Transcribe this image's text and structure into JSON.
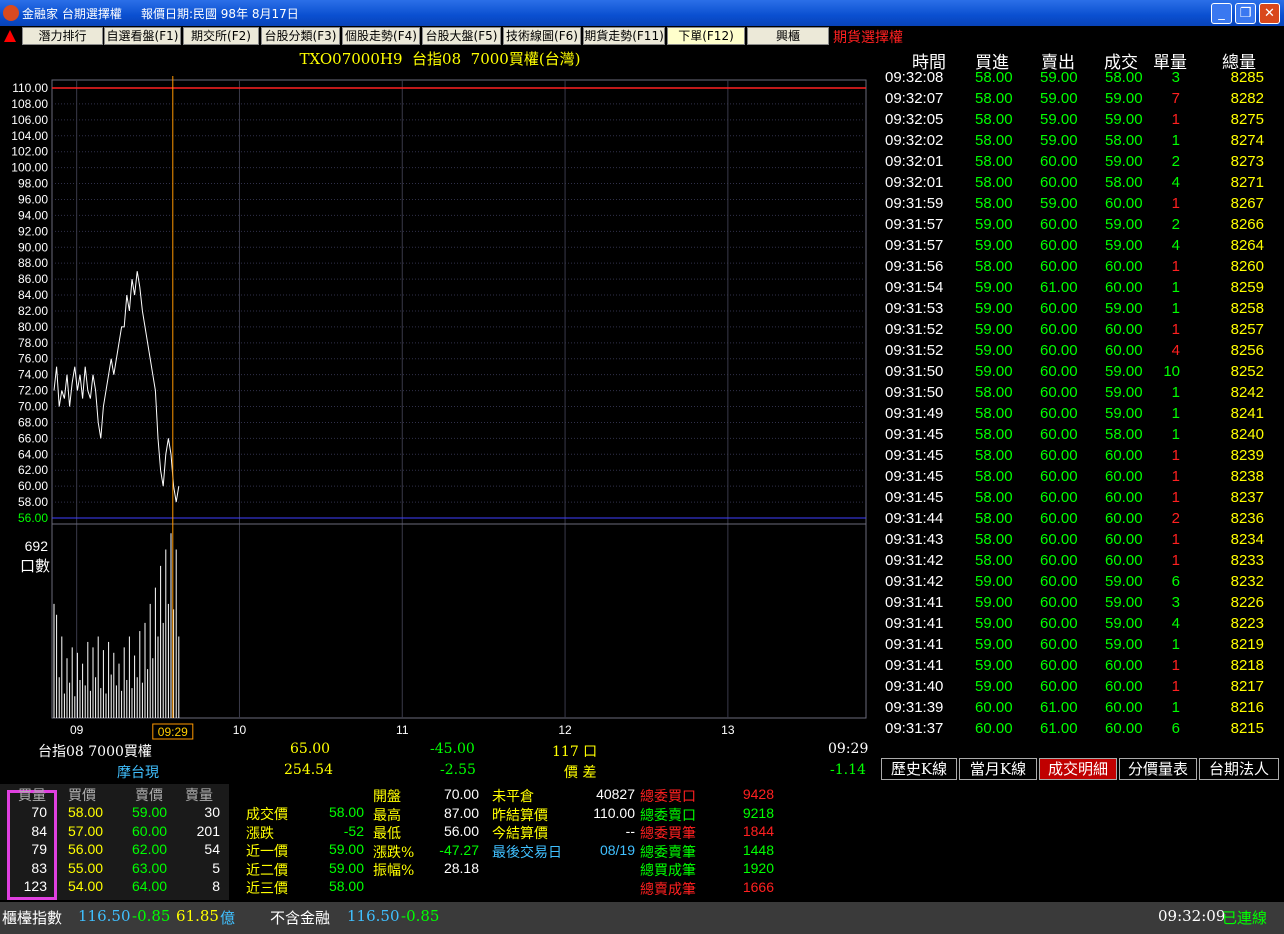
{
  "window": {
    "app_name": "金融家",
    "window_name": "台期選擇權",
    "quote_date": "報價日期:民國 98年 8月17日"
  },
  "tabs": [
    {
      "label": "潛力排行",
      "active": false
    },
    {
      "label": "自選看盤(F1)",
      "active": false
    },
    {
      "label": "期交所(F2)",
      "active": false
    },
    {
      "label": "台股分類(F3)",
      "active": false
    },
    {
      "label": "個股走勢(F4)",
      "active": false
    },
    {
      "label": "台股大盤(F5)",
      "active": false
    },
    {
      "label": "技術線圖(F6)",
      "active": false
    },
    {
      "label": "期貨走勢(F11)",
      "active": false
    },
    {
      "label": "下單(F12)",
      "active": true
    },
    {
      "label": "興櫃",
      "active": false
    }
  ],
  "futures_label": "期貨選擇權",
  "chart_title": "TXO07000H9  台指08  7000買權(台灣)",
  "chart_data": {
    "type": "line",
    "ylim": [
      56,
      110
    ],
    "y_ticks": [
      "110.00",
      "108.00",
      "106.00",
      "104.00",
      "102.00",
      "100.00",
      "98.00",
      "96.00",
      "94.00",
      "92.00",
      "90.00",
      "88.00",
      "86.00",
      "84.00",
      "82.00",
      "80.00",
      "78.00",
      "76.00",
      "74.00",
      "72.00",
      "70.00",
      "68.00",
      "66.00",
      "64.00",
      "62.00",
      "60.00",
      "58.00",
      "56.00"
    ],
    "ref_line": 110,
    "low_line": 56,
    "prices": [
      72,
      75,
      70,
      72,
      71,
      74,
      70,
      73,
      75,
      72,
      74,
      71,
      75,
      72,
      71,
      74,
      72,
      68,
      66,
      70,
      72,
      74,
      76,
      74,
      76,
      78,
      80,
      80,
      84,
      82,
      86,
      84,
      87,
      85,
      82,
      80,
      78,
      76,
      74,
      72,
      66,
      62,
      60,
      64,
      66,
      64,
      60,
      58,
      60
    ],
    "x_ticks": [
      {
        "label": "09",
        "slot": 5
      },
      {
        "label": "10",
        "slot": 38
      },
      {
        "label": "11",
        "slot": 71
      },
      {
        "label": "12",
        "slot": 104
      },
      {
        "label": "13",
        "slot": 137
      }
    ],
    "cursor_label": "09:29",
    "volume_max_label": "692",
    "volume_unit": "口數",
    "volume_max": 692,
    "volumes": [
      420,
      380,
      150,
      300,
      90,
      220,
      130,
      260,
      80,
      240,
      140,
      200,
      120,
      280,
      100,
      260,
      150,
      300,
      110,
      250,
      90,
      280,
      160,
      240,
      120,
      200,
      100,
      260,
      140,
      300,
      110,
      230,
      150,
      320,
      130,
      350,
      180,
      420,
      220,
      480,
      300,
      560,
      350,
      620,
      420,
      680,
      400,
      620,
      300
    ]
  },
  "info_row1": {
    "name": "台指08  7000買權",
    "price": "65.00",
    "change": "-45.00",
    "volume": "117 口",
    "time": "09:29"
  },
  "info_row2": {
    "name": "摩台現",
    "price": "254.54",
    "change": "-2.55",
    "label": "價 差",
    "spread": "-1.14"
  },
  "trades_header": [
    "時間",
    "買進",
    "賣出",
    "成交",
    "單量",
    "總量"
  ],
  "trades": [
    {
      "t": "09:32:08",
      "b": "58.00",
      "s": "59.00",
      "p": "58.00",
      "q": "3",
      "tot": "8285",
      "qc": "#00ff00"
    },
    {
      "t": "09:32:07",
      "b": "58.00",
      "s": "59.00",
      "p": "59.00",
      "q": "7",
      "tot": "8282",
      "qc": "#ff2020"
    },
    {
      "t": "09:32:05",
      "b": "58.00",
      "s": "59.00",
      "p": "59.00",
      "q": "1",
      "tot": "8275",
      "qc": "#ff2020"
    },
    {
      "t": "09:32:02",
      "b": "58.00",
      "s": "59.00",
      "p": "58.00",
      "q": "1",
      "tot": "8274",
      "qc": "#00ff00"
    },
    {
      "t": "09:32:01",
      "b": "58.00",
      "s": "60.00",
      "p": "59.00",
      "q": "2",
      "tot": "8273",
      "qc": "#00ff00"
    },
    {
      "t": "09:32:01",
      "b": "58.00",
      "s": "60.00",
      "p": "58.00",
      "q": "4",
      "tot": "8271",
      "qc": "#00ff00"
    },
    {
      "t": "09:31:59",
      "b": "58.00",
      "s": "59.00",
      "p": "60.00",
      "q": "1",
      "tot": "8267",
      "qc": "#ff2020"
    },
    {
      "t": "09:31:57",
      "b": "59.00",
      "s": "60.00",
      "p": "59.00",
      "q": "2",
      "tot": "8266",
      "qc": "#00ff00"
    },
    {
      "t": "09:31:57",
      "b": "59.00",
      "s": "60.00",
      "p": "59.00",
      "q": "4",
      "tot": "8264",
      "qc": "#00ff00"
    },
    {
      "t": "09:31:56",
      "b": "58.00",
      "s": "60.00",
      "p": "60.00",
      "q": "1",
      "tot": "8260",
      "qc": "#ff2020"
    },
    {
      "t": "09:31:54",
      "b": "59.00",
      "s": "61.00",
      "p": "60.00",
      "q": "1",
      "tot": "8259",
      "qc": "#00ff00"
    },
    {
      "t": "09:31:53",
      "b": "59.00",
      "s": "60.00",
      "p": "59.00",
      "q": "1",
      "tot": "8258",
      "qc": "#00ff00"
    },
    {
      "t": "09:31:52",
      "b": "59.00",
      "s": "60.00",
      "p": "60.00",
      "q": "1",
      "tot": "8257",
      "qc": "#ff2020"
    },
    {
      "t": "09:31:52",
      "b": "59.00",
      "s": "60.00",
      "p": "60.00",
      "q": "4",
      "tot": "8256",
      "qc": "#ff2020"
    },
    {
      "t": "09:31:50",
      "b": "59.00",
      "s": "60.00",
      "p": "59.00",
      "q": "10",
      "tot": "8252",
      "qc": "#00ff00"
    },
    {
      "t": "09:31:50",
      "b": "58.00",
      "s": "60.00",
      "p": "59.00",
      "q": "1",
      "tot": "8242",
      "qc": "#00ff00"
    },
    {
      "t": "09:31:49",
      "b": "58.00",
      "s": "60.00",
      "p": "59.00",
      "q": "1",
      "tot": "8241",
      "qc": "#00ff00"
    },
    {
      "t": "09:31:45",
      "b": "58.00",
      "s": "60.00",
      "p": "58.00",
      "q": "1",
      "tot": "8240",
      "qc": "#00ff00"
    },
    {
      "t": "09:31:45",
      "b": "58.00",
      "s": "60.00",
      "p": "60.00",
      "q": "1",
      "tot": "8239",
      "qc": "#ff2020"
    },
    {
      "t": "09:31:45",
      "b": "58.00",
      "s": "60.00",
      "p": "60.00",
      "q": "1",
      "tot": "8238",
      "qc": "#ff2020"
    },
    {
      "t": "09:31:45",
      "b": "58.00",
      "s": "60.00",
      "p": "60.00",
      "q": "1",
      "tot": "8237",
      "qc": "#ff2020"
    },
    {
      "t": "09:31:44",
      "b": "58.00",
      "s": "60.00",
      "p": "60.00",
      "q": "2",
      "tot": "8236",
      "qc": "#ff2020"
    },
    {
      "t": "09:31:43",
      "b": "58.00",
      "s": "60.00",
      "p": "60.00",
      "q": "1",
      "tot": "8234",
      "qc": "#ff2020"
    },
    {
      "t": "09:31:42",
      "b": "58.00",
      "s": "60.00",
      "p": "60.00",
      "q": "1",
      "tot": "8233",
      "qc": "#ff2020"
    },
    {
      "t": "09:31:42",
      "b": "59.00",
      "s": "60.00",
      "p": "59.00",
      "q": "6",
      "tot": "8232",
      "qc": "#00ff00"
    },
    {
      "t": "09:31:41",
      "b": "59.00",
      "s": "60.00",
      "p": "59.00",
      "q": "3",
      "tot": "8226",
      "qc": "#00ff00"
    },
    {
      "t": "09:31:41",
      "b": "59.00",
      "s": "60.00",
      "p": "59.00",
      "q": "4",
      "tot": "8223",
      "qc": "#00ff00"
    },
    {
      "t": "09:31:41",
      "b": "59.00",
      "s": "60.00",
      "p": "59.00",
      "q": "1",
      "tot": "8219",
      "qc": "#00ff00"
    },
    {
      "t": "09:31:41",
      "b": "59.00",
      "s": "60.00",
      "p": "60.00",
      "q": "1",
      "tot": "8218",
      "qc": "#ff2020"
    },
    {
      "t": "09:31:40",
      "b": "59.00",
      "s": "60.00",
      "p": "60.00",
      "q": "1",
      "tot": "8217",
      "qc": "#ff2020"
    },
    {
      "t": "09:31:39",
      "b": "60.00",
      "s": "61.00",
      "p": "60.00",
      "q": "1",
      "tot": "8216",
      "qc": "#00ff00"
    },
    {
      "t": "09:31:37",
      "b": "60.00",
      "s": "61.00",
      "p": "60.00",
      "q": "6",
      "tot": "8215",
      "qc": "#00ff00"
    }
  ],
  "sub_tabs": [
    {
      "label": "歷史K線",
      "active": false
    },
    {
      "label": "當月K線",
      "active": false
    },
    {
      "label": "成交明細",
      "active": true
    },
    {
      "label": "分價量表",
      "active": false
    },
    {
      "label": "台期法人",
      "active": false
    }
  ],
  "depth_header": [
    "買量",
    "買價",
    "賣價",
    "賣量"
  ],
  "depth": [
    {
      "bq": "70",
      "bp": "58.00",
      "ap": "59.00",
      "aq": "30"
    },
    {
      "bq": "84",
      "bp": "57.00",
      "ap": "60.00",
      "aq": "201"
    },
    {
      "bq": "79",
      "bp": "56.00",
      "ap": "62.00",
      "aq": "54"
    },
    {
      "bq": "83",
      "bp": "55.00",
      "ap": "63.00",
      "aq": "5"
    },
    {
      "bq": "123",
      "bp": "54.00",
      "ap": "64.00",
      "aq": "8"
    }
  ],
  "last_prices": [
    {
      "label": "成交價",
      "value": "58.00",
      "color": "#00ff00"
    },
    {
      "label": "漲跌",
      "value": "-52",
      "color": "#00ff00"
    },
    {
      "label": "近一價",
      "value": "59.00",
      "color": "#00ff00"
    },
    {
      "label": "近二價",
      "value": "59.00",
      "color": "#00ff00"
    },
    {
      "label": "近三價",
      "value": "58.00",
      "color": "#00ff00"
    }
  ],
  "ohlc": [
    {
      "label": "開盤",
      "value": "70.00",
      "color": "#ffffff"
    },
    {
      "label": "最高",
      "value": "87.00",
      "color": "#ffffff"
    },
    {
      "label": "最低",
      "value": "56.00",
      "color": "#ffffff"
    },
    {
      "label": "漲跌%",
      "value": "-47.27",
      "color": "#00ff00"
    },
    {
      "label": "振幅%",
      "value": "28.18",
      "color": "#ffffff"
    }
  ],
  "settle": [
    {
      "label": "未平倉",
      "value": "40827",
      "color": "#ffffff",
      "lcolor": "#ffffff"
    },
    {
      "label": "昨結算價",
      "value": "110.00",
      "color": "#ffffff",
      "lcolor": "#ffffff"
    },
    {
      "label": "今結算價",
      "value": "--",
      "color": "#ffffff",
      "lcolor": "#ffffff"
    },
    {
      "label": "最後交易日",
      "value": "08/19",
      "color": "#40c0ff",
      "lcolor": "#40c0ff"
    }
  ],
  "orders": [
    {
      "label": "總委買口",
      "value": "9428",
      "color": "#ff2020"
    },
    {
      "label": "總委賣口",
      "value": "9218",
      "color": "#00ff00"
    },
    {
      "label": "總委買筆",
      "value": "1844",
      "color": "#ff2020"
    },
    {
      "label": "總委賣筆",
      "value": "1448",
      "color": "#00ff00"
    },
    {
      "label": "總買成筆",
      "value": "1920",
      "color": "#00ff00"
    },
    {
      "label": "總賣成筆",
      "value": "1666",
      "color": "#ff2020"
    }
  ],
  "status": {
    "index_label": "櫃檯指數",
    "index_value": "116.50",
    "index_change": "-0.85",
    "index_amount": "61.85",
    "amount_unit": "億",
    "ex_fin_label": "不含金融",
    "ex_fin_value": "116.50",
    "ex_fin_change": "-0.85",
    "clock": "09:32:09",
    "conn": "已連線"
  }
}
